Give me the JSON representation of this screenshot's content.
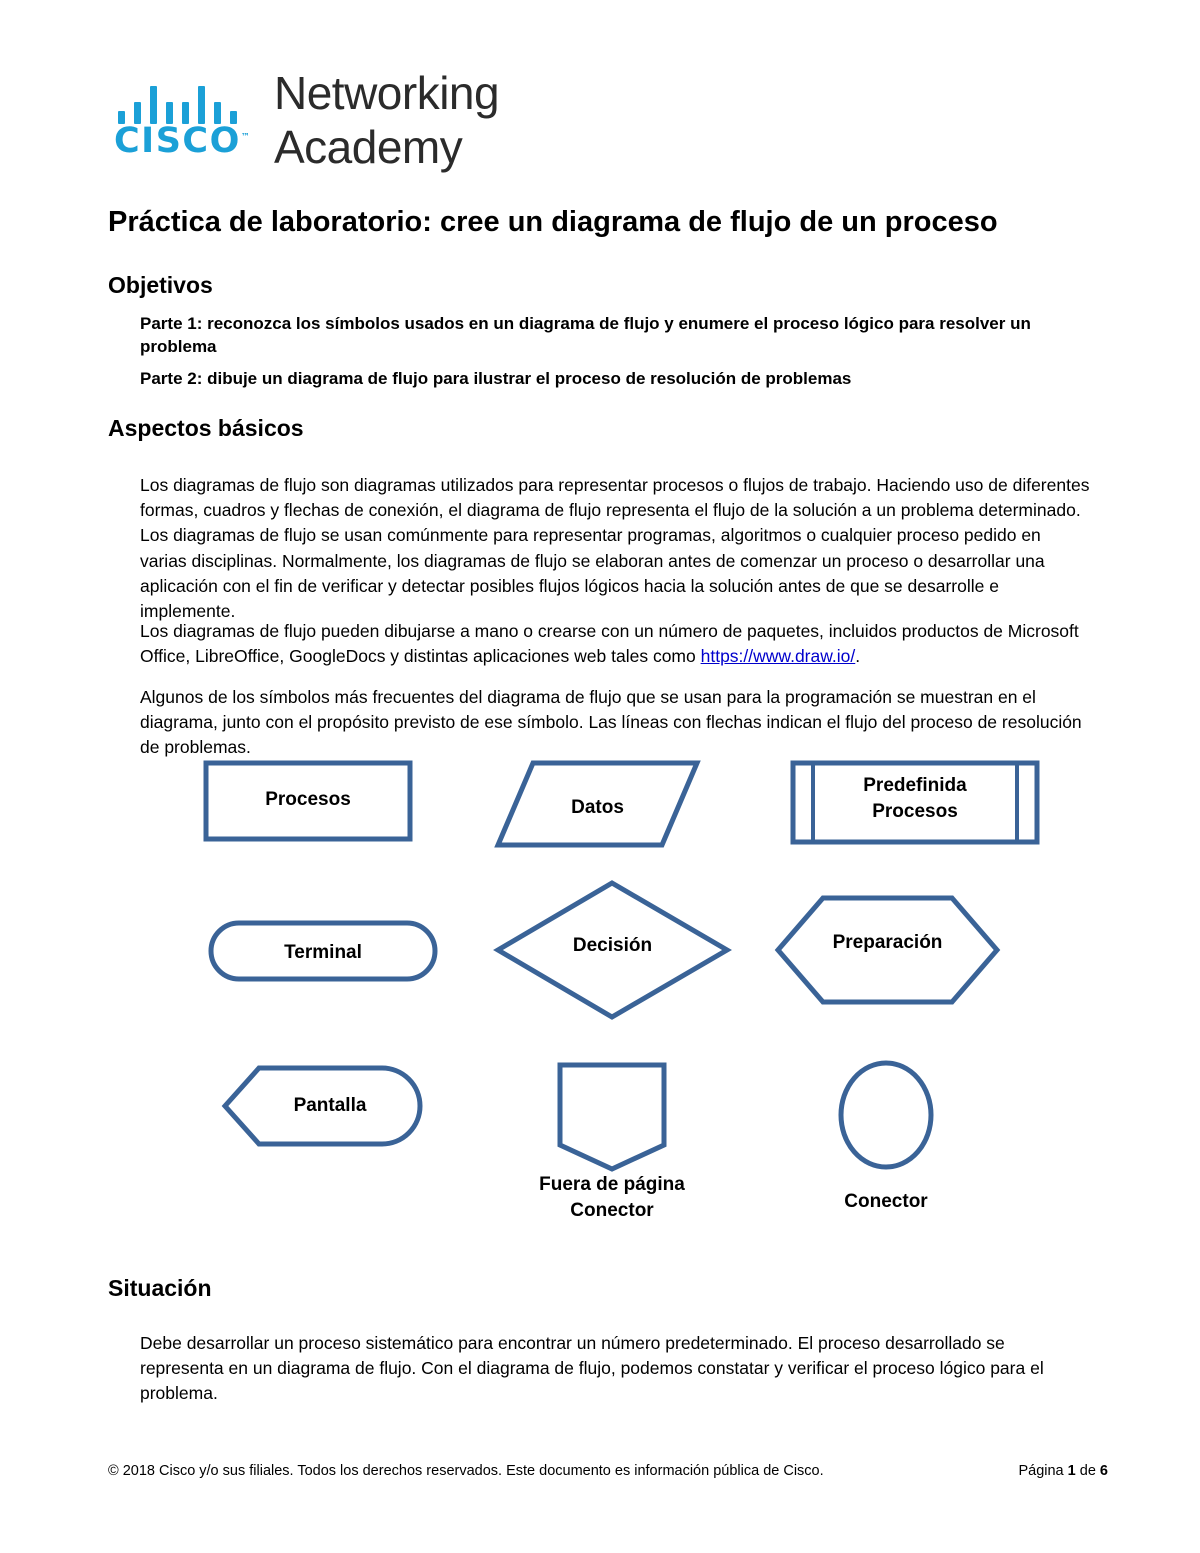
{
  "logo": {
    "brand": "CISCO",
    "trademark": "™",
    "line1": "Networking",
    "line2": "Academy",
    "brand_color": "#1BA0D7"
  },
  "document": {
    "title": "Práctica de laboratorio: cree un diagrama de flujo de un proceso"
  },
  "objetivos": {
    "heading": "Objetivos",
    "items": [
      "Parte 1: reconozca los símbolos usados en un diagrama de flujo y enumere el proceso lógico para resolver un problema",
      "Parte 2: dibuje un diagrama de flujo para ilustrar el proceso de resolución de problemas"
    ]
  },
  "aspectos": {
    "heading": "Aspectos básicos",
    "paragraph1": "Los diagramas de flujo son diagramas utilizados para representar procesos o flujos de trabajo. Haciendo uso de diferentes formas, cuadros y flechas de conexión, el diagrama de flujo representa el flujo de la solución a un problema determinado. Los diagramas de flujo se usan comúnmente para representar programas, algoritmos o cualquier proceso pedido en varias disciplinas. Normalmente, los diagramas de flujo se elaboran antes de comenzar un proceso o desarrollar una aplicación con el fin de verificar y detectar posibles flujos lógicos hacia la solución antes de que se desarrolle e implemente.",
    "paragraph2_before": "Los diagramas de flujo pueden dibujarse a mano o crearse con un número de paquetes, incluidos productos de Microsoft Office, LibreOffice, GoogleDocs y distintas aplicaciones web tales como ",
    "paragraph2_link": "https://www.draw.io/",
    "paragraph2_after": ".",
    "paragraph3": "Algunos de los símbolos más frecuentes del diagrama de flujo que se usan para la programación se muestran en el diagrama, junto con el propósito previsto de ese símbolo. Las líneas con flechas indican el flujo del proceso de resolución de problemas."
  },
  "flowchart": {
    "shapes": [
      {
        "id": "procesos",
        "label": "Procesos",
        "shape": "rectangle",
        "label_position": "inside"
      },
      {
        "id": "datos",
        "label": "Datos",
        "shape": "parallelogram",
        "label_position": "inside"
      },
      {
        "id": "predefinida",
        "label": "Predefinida\nProcesos",
        "label_line1": "Predefinida",
        "label_line2": "Procesos",
        "shape": "predefined-process",
        "label_position": "inside"
      },
      {
        "id": "terminal",
        "label": "Terminal",
        "shape": "stadium",
        "label_position": "inside"
      },
      {
        "id": "decision",
        "label": "Decisión",
        "shape": "diamond",
        "label_position": "inside"
      },
      {
        "id": "preparacion",
        "label": "Preparación",
        "shape": "hexagon",
        "label_position": "inside"
      },
      {
        "id": "pantalla",
        "label": "Pantalla",
        "shape": "display",
        "label_position": "inside"
      },
      {
        "id": "fuera-de-pagina",
        "label": "Fuera de página\nConector",
        "label_line1": "Fuera de página",
        "label_line2": "Conector",
        "shape": "off-page-connector",
        "label_position": "below"
      },
      {
        "id": "conector",
        "label": "Conector",
        "shape": "circle",
        "label_position": "below"
      }
    ],
    "stroke_color": "#3A6397",
    "fill_color": "#FFFFFF"
  },
  "situacion": {
    "heading": "Situación",
    "paragraph": "Debe desarrollar un proceso sistemático para encontrar un número predeterminado. El proceso desarrollado se representa en un diagrama de flujo. Con el diagrama de flujo, podemos constatar y verificar el proceso lógico para el problema."
  },
  "footer": {
    "copyright": "© 2018 Cisco y/o sus filiales. Todos los derechos reservados. Este documento es información pública de Cisco.",
    "page_prefix": "Página ",
    "page_number": "1",
    "page_mid": " de ",
    "page_total": "6"
  }
}
